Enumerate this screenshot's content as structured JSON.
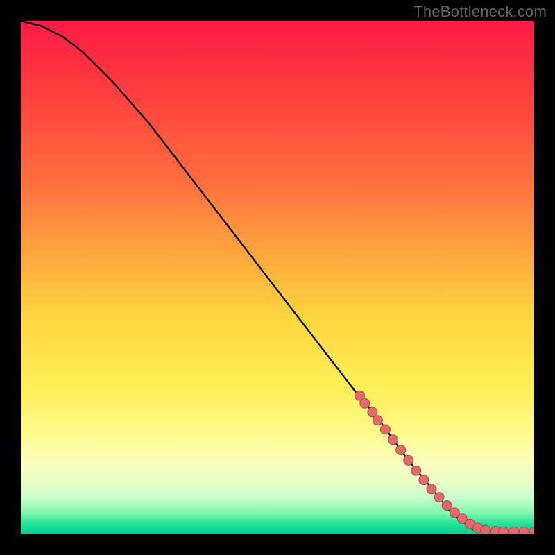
{
  "watermark": "TheBottleneck.com",
  "colors": {
    "page_bg": "#000000",
    "watermark": "#666666",
    "curve": "#000000",
    "marker_fill": "#e26a6a",
    "marker_stroke": "#b04848",
    "gradient_stops": [
      "#ff1a47",
      "#ff3a3e",
      "#ff6a3e",
      "#ffa83e",
      "#ffd63e",
      "#fff05a",
      "#fffb8a",
      "#fbffbf",
      "#e8ffc7",
      "#c6ffcf",
      "#7cf7a9",
      "#22e39a",
      "#00cf94"
    ]
  },
  "chart_data": {
    "type": "line",
    "title": "",
    "xlabel": "",
    "ylabel": "",
    "xlim": [
      0,
      100
    ],
    "ylim": [
      0,
      100
    ],
    "curve": {
      "name": "bottleneck-curve",
      "x": [
        0,
        4,
        8,
        12,
        18,
        25,
        35,
        45,
        55,
        65,
        70,
        75,
        80,
        84,
        88,
        92,
        96,
        100
      ],
      "y": [
        100,
        99,
        97,
        94,
        88,
        80,
        67,
        54,
        41,
        28,
        22,
        15,
        9,
        4,
        1,
        0.5,
        0.5,
        0.5
      ]
    },
    "markers": {
      "name": "highlighted-points",
      "x": [
        66,
        67,
        68.5,
        69.5,
        71,
        72.5,
        74,
        75.5,
        77,
        78.5,
        80,
        81.5,
        83,
        84.5,
        86,
        87.5,
        89,
        90.5,
        92.5,
        94,
        96,
        98,
        100
      ],
      "y": [
        27,
        25.5,
        23.8,
        22.2,
        20.4,
        18.4,
        16.4,
        14.4,
        12.4,
        10.6,
        8.8,
        7.2,
        5.6,
        4.2,
        3.0,
        2.0,
        1.2,
        0.8,
        0.6,
        0.5,
        0.5,
        0.5,
        0.5
      ]
    }
  }
}
